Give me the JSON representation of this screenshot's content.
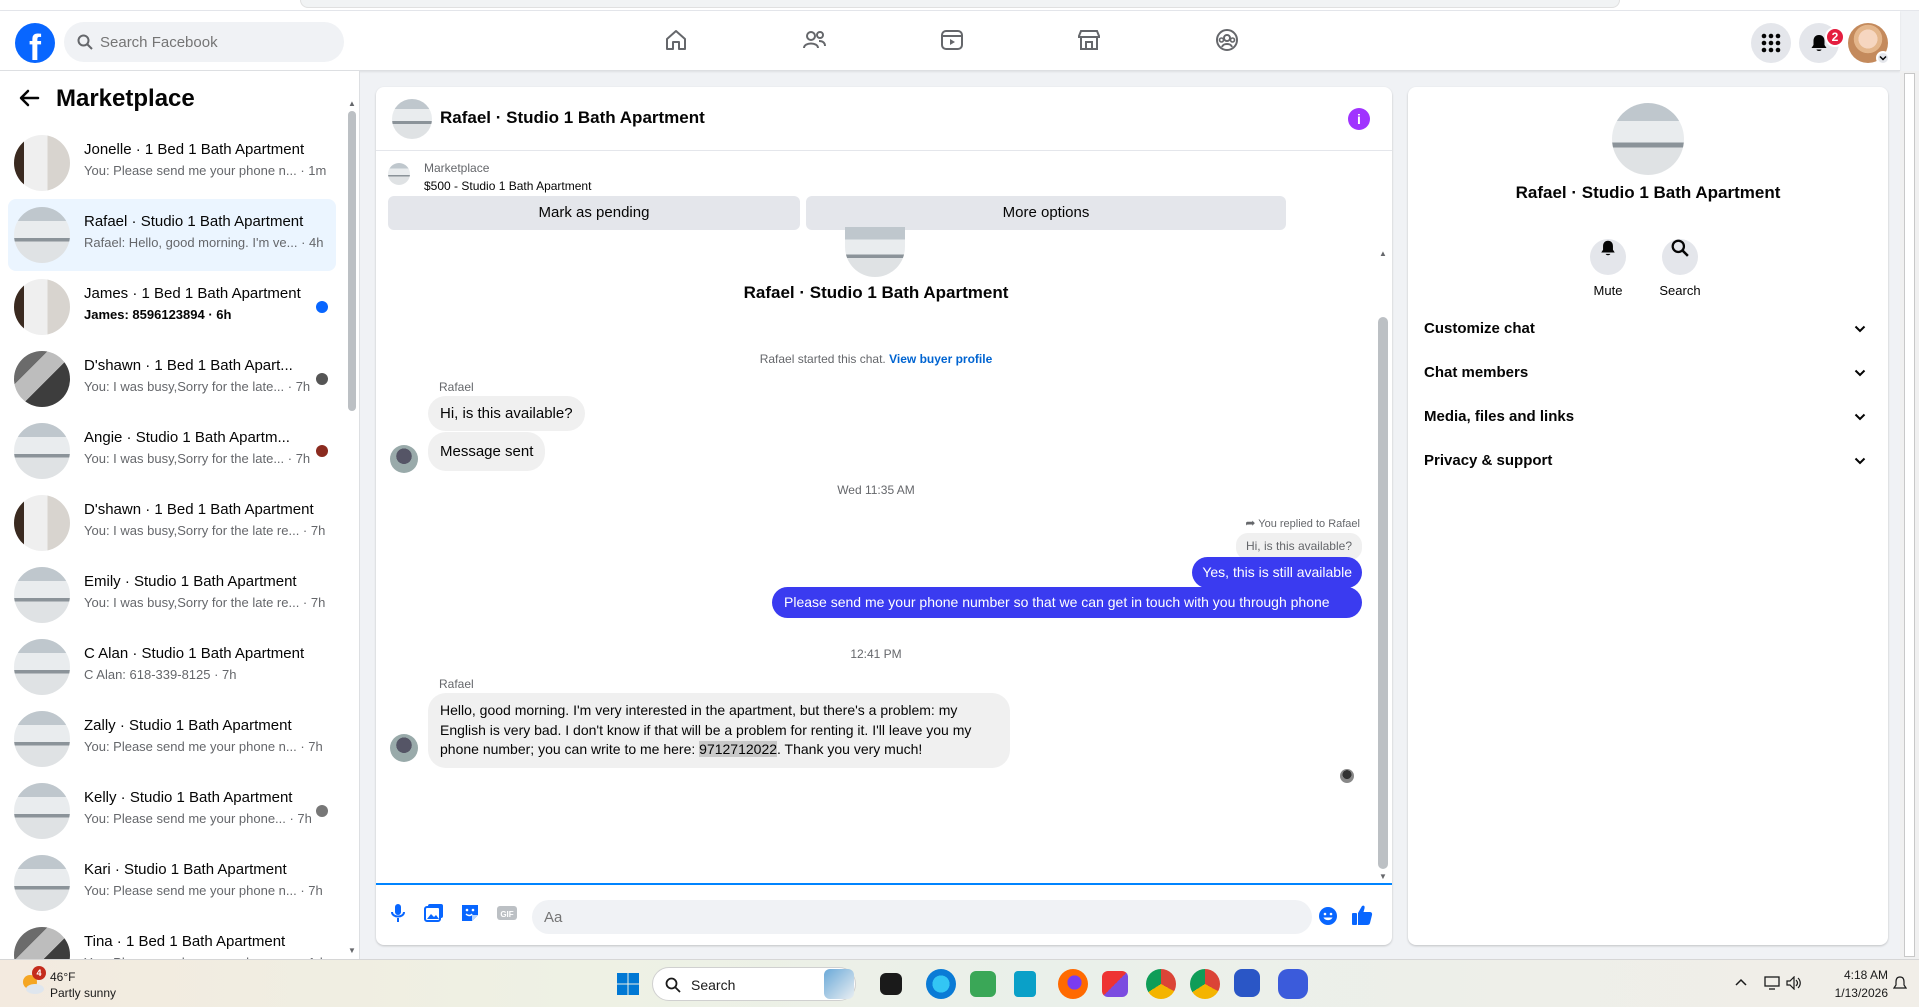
{
  "search": {
    "placeholder": "Search Facebook"
  },
  "nav": {
    "notification_count": "2"
  },
  "left": {
    "title": "Marketplace",
    "conversations": [
      {
        "name": "Jonelle · 1 Bed 1 Bath Apartment",
        "preview": "You: Please send me your phone n... · 1m",
        "bold": false
      },
      {
        "name": "Rafael · Studio 1 Bath Apartment",
        "preview": "Rafael: Hello, good morning. I'm ve... · 4h",
        "bold": false
      },
      {
        "name": "James · 1 Bed 1 Bath Apartment",
        "preview": "James: 8596123894 · 6h",
        "bold": true
      },
      {
        "name": "D'shawn · 1 Bed 1 Bath Apart...",
        "preview": "You: I was busy,Sorry for the late... · 7h",
        "bold": false
      },
      {
        "name": "Angie · Studio 1 Bath Apartm...",
        "preview": "You: I was busy,Sorry for the late... · 7h",
        "bold": false
      },
      {
        "name": "D'shawn · 1 Bed 1 Bath Apartment",
        "preview": "You: I was busy,Sorry for the late re... · 7h",
        "bold": false
      },
      {
        "name": "Emily · Studio 1 Bath Apartment",
        "preview": "You: I was busy,Sorry for the late re... · 7h",
        "bold": false
      },
      {
        "name": "C Alan · Studio 1 Bath Apartment",
        "preview": "C Alan: 618-339-8125 · 7h",
        "bold": false
      },
      {
        "name": "Zally · Studio 1 Bath Apartment",
        "preview": "You: Please send me your phone n... · 7h",
        "bold": false
      },
      {
        "name": "Kelly · Studio 1 Bath Apartment",
        "preview": "You: Please send me your phone... · 7h",
        "bold": false
      },
      {
        "name": "Kari · Studio 1 Bath Apartment",
        "preview": "You: Please send me your phone n... · 7h",
        "bold": false
      },
      {
        "name": "Tina · 1 Bed 1 Bath Apartment",
        "preview": "You: Please send me your phone n... · 1d",
        "bold": false
      }
    ]
  },
  "chat": {
    "title": "Rafael · Studio 1 Bath Apartment",
    "listing_kind": "Marketplace",
    "listing_price": "$500 - Studio 1 Bath Apartment",
    "mark_pending": "Mark as pending",
    "more_options": "More options",
    "intro_title": "Rafael · Studio 1 Bath Apartment",
    "started_text": "Rafael started this chat.",
    "view_buyer_profile": "View buyer profile",
    "sender1": "Rafael",
    "msg1": "Hi, is this available?",
    "msg2": "Message sent",
    "time1": "Wed 11:35 AM",
    "replied_to": "You replied to Rafael",
    "quoted": "Hi, is this available?",
    "out1": "Yes, this is still available",
    "out2": "Please send me your phone  number so that we can get in touch with you through phone",
    "time2": "12:41 PM",
    "sender2": "Rafael",
    "msg3_pre": "Hello, good morning. I'm very interested in the apartment, but there's a problem: my English is very bad. I don't know if that will be a problem for renting it. I'll leave you my phone number; you can write to me here: ",
    "msg3_phone": "9712712022",
    "msg3_post": ". Thank you very much!",
    "composer_placeholder": "Aa"
  },
  "right": {
    "title": "Rafael · Studio 1 Bath Apartment",
    "mute": "Mute",
    "search": "Search",
    "rows": [
      "Customize chat",
      "Chat members",
      "Media, files and links",
      "Privacy & support"
    ]
  },
  "taskbar": {
    "weather_badge": "4",
    "temp": "46°F",
    "weather_desc": "Partly sunny",
    "search": "Search",
    "time": "4:18 AM",
    "date": "1/13/2026"
  },
  "colors": {
    "fb_blue": "#0866ff",
    "outgoing_bubble": "#3a3bf0",
    "unread_dot": "#0866ff",
    "info_purple": "#a033ff"
  }
}
